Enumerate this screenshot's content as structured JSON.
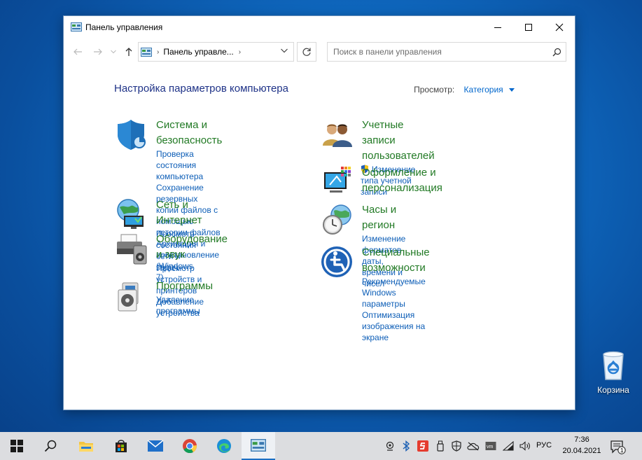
{
  "desktop": {
    "recycle_bin_label": "Корзина"
  },
  "window": {
    "title": "Панель управления",
    "controls": {
      "minimize_icon": "minimize-icon",
      "maximize_icon": "maximize-icon",
      "close_icon": "close-icon"
    },
    "address": {
      "breadcrumb": "Панель управле...",
      "separator": "›"
    },
    "search": {
      "placeholder": "Поиск в панели управления"
    },
    "heading": "Настройка параметров компьютера",
    "view": {
      "label": "Просмотр:",
      "value": "Категория"
    }
  },
  "categories": [
    {
      "title": "Система и безопасность",
      "icon": "shield-icon",
      "links": [
        "Проверка состояния компьютера",
        "Сохранение резервных копий файлов с",
        "помощью истории файлов",
        "Архивация и восстановление (Windows",
        "7)"
      ]
    },
    {
      "title": "Сеть и Интернет",
      "icon": "network-globe-icon",
      "links": [
        "Просмотр состояния сети и задач"
      ]
    },
    {
      "title": "Оборудование и звук",
      "icon": "printer-icon",
      "links": [
        "Просмотр устройств и принтеров",
        "Добавление устройства"
      ]
    },
    {
      "title": "Программы",
      "icon": "programs-icon",
      "links": [
        "Удаление программы"
      ]
    },
    {
      "title_line1": "Учетные записи",
      "title_line2": "пользователей",
      "icon": "users-icon",
      "links": [
        "Изменение типа учетной записи"
      ]
    },
    {
      "title_line1": "Оформление и",
      "title_line2": "персонализация",
      "icon": "appearance-icon",
      "links": []
    },
    {
      "title": "Часы и регион",
      "icon": "clock-globe-icon",
      "links": [
        "Изменение форматов даты, времени и",
        "чисел"
      ]
    },
    {
      "title": "Специальные возможности",
      "icon": "accessibility-icon",
      "links": [
        "Рекомендуемые Windows параметры",
        "Оптимизация изображения на экране"
      ]
    }
  ],
  "taskbar": {
    "apps": [
      "start-icon",
      "search-icon",
      "file-explorer-icon",
      "store-icon",
      "mail-icon",
      "chrome-icon",
      "edge-icon",
      "control-panel-icon"
    ],
    "language": "РУС",
    "time": "7:36",
    "date": "20.04.2021",
    "notifications_count": "1"
  },
  "colors": {
    "title_green": "#227a25",
    "link_blue": "#0d5eb7",
    "heading_navy": "#1e3287",
    "taskbar": "#dcdde0"
  }
}
